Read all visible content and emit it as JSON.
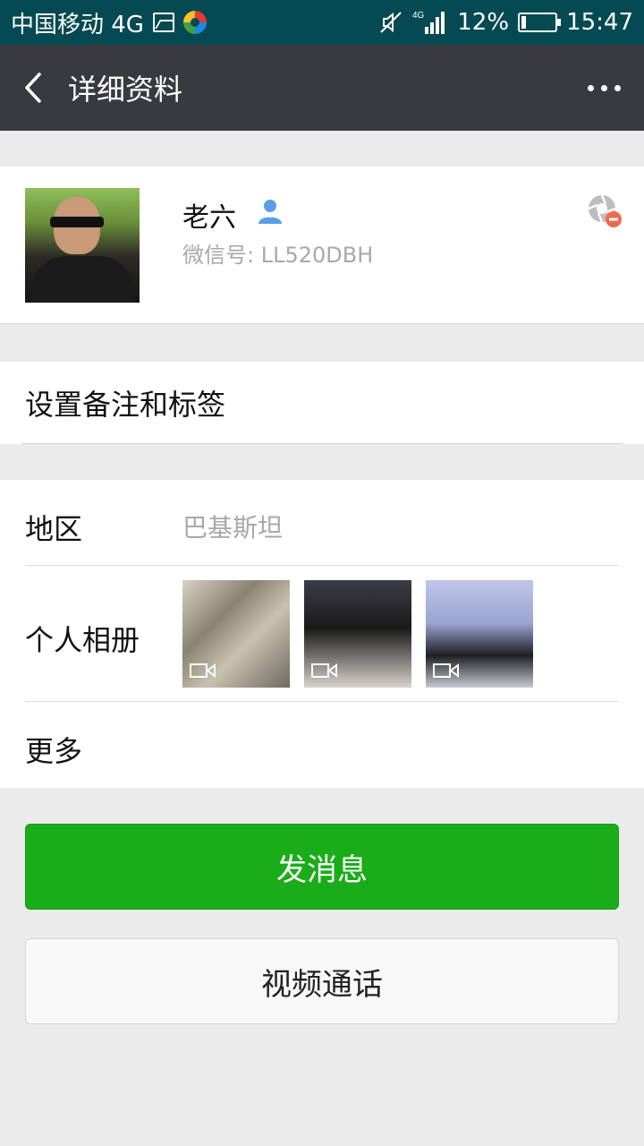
{
  "status_bar": {
    "carrier": "中国移动 4G",
    "network": "4G",
    "battery": "12%",
    "time": "15:47"
  },
  "header": {
    "title": "详细资料",
    "icons": {
      "back": "back-arrow-icon",
      "more": "more-dots-icon"
    }
  },
  "profile": {
    "name": "老六",
    "wechat_id": "微信号: LL520DBH",
    "icons": {
      "contact": "contact-person-icon",
      "status": "blocked-icon"
    }
  },
  "remark": {
    "label": "设置备注和标签"
  },
  "info": {
    "region_label": "地区",
    "region_value": "巴基斯坦",
    "album_label": "个人相册",
    "more_label": "更多"
  },
  "actions": {
    "send_message": "发消息",
    "video_call": "视频通话"
  },
  "colors": {
    "status_bar": "#054a52",
    "title_bar": "#393a3f",
    "primary_green": "#1aad19",
    "background": "#ebebeb"
  }
}
